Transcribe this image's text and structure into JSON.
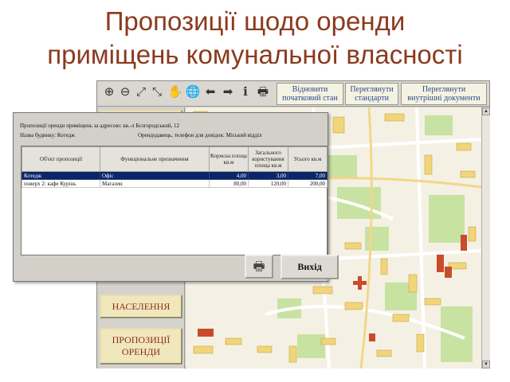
{
  "slide": {
    "title_line1": "Пропозиції щодо оренди",
    "title_line2": "приміщень комунальної власності"
  },
  "toolbar": {
    "tools": [
      {
        "name": "zoom-in-icon",
        "glyph": "⊕"
      },
      {
        "name": "zoom-out-icon",
        "glyph": "⊖"
      },
      {
        "name": "zoom-window-icon",
        "glyph": "⤢"
      },
      {
        "name": "zoom-extent-icon",
        "glyph": "⤡"
      },
      {
        "name": "pan-hand-icon",
        "glyph": "✋"
      },
      {
        "name": "globe-icon",
        "glyph": "🌐"
      },
      {
        "name": "back-arrow-icon",
        "glyph": "⬅"
      },
      {
        "name": "forward-arrow-icon",
        "glyph": "➡"
      },
      {
        "name": "info-icon",
        "glyph": "ℹ"
      },
      {
        "name": "printer-icon",
        "glyph": "🖶"
      }
    ],
    "restore_label": "Відновити\nпочатковий стан",
    "standards_label": "Переглянути\nстандарти",
    "internal_docs_label": "Переглянути\nвнутрішні документи"
  },
  "sidebar": {
    "population_label": "НАСЕЛЕННЯ",
    "rent_offers_label": "ПРОПОЗИЦІЇ\nОРЕНДИ"
  },
  "dialog": {
    "address_line": "Пропозиції оренди приміщень за адресою: кв.-л Бєлгородський, 12",
    "building_line": "Назва будинку: Котедж",
    "landlord_line": "Орендодавець, телефон для довідок: Міський відділ",
    "columns": [
      "Об'єкт пропозиції",
      "Функціональне призначення",
      "Корисна площа кв.м",
      "Загального користування площа кв.м",
      "Усього кв.м"
    ],
    "rows": [
      {
        "object": "Котедж",
        "function": "Офіс",
        "useful": "4,00",
        "common": "3,00",
        "total": "7,00",
        "selected": true
      },
      {
        "object": "поверх 2: кафе Курінь",
        "function": "Магазин",
        "useful": "80,00",
        "common": "120,00",
        "total": "200,00",
        "selected": false
      }
    ],
    "exit_label": "Вихід",
    "print_icon": "printer-icon"
  },
  "colors": {
    "title": "#8b3a1e",
    "button_text": "#2c4a8c",
    "sidebar_text": "#8b2e1a",
    "selection": "#0c2566",
    "map_green": "#c8e2a2",
    "map_building": "#f1d57a",
    "map_highlight": "#c84b2e"
  }
}
